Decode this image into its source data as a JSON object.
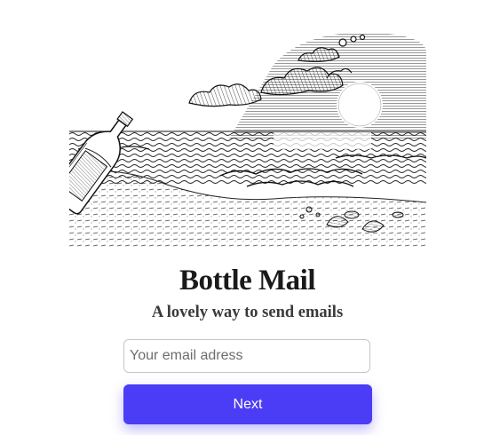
{
  "app": {
    "title": "Bottle Mail",
    "tagline": "A lovely way to send emails"
  },
  "form": {
    "email_placeholder": "Your email adress",
    "email_value": "",
    "next_label": "Next"
  },
  "illustration": {
    "icon": "message-in-a-bottle-sketch",
    "style": "black-and-white engraving"
  },
  "colors": {
    "accent": "#4b3df5",
    "text": "#1a1a1a",
    "subtitle": "#3a3a3a",
    "input_border": "#c6c6c6"
  }
}
